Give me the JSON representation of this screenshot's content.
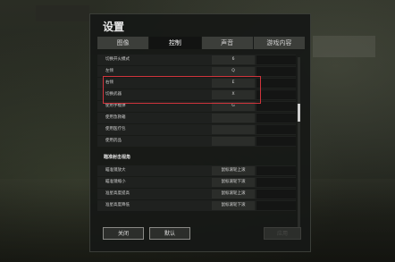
{
  "window": {
    "title": "设置"
  },
  "tabs": [
    {
      "label": "图像",
      "active": false
    },
    {
      "label": "控制",
      "active": true
    },
    {
      "label": "声音",
      "active": false
    },
    {
      "label": "游戏内容",
      "active": false
    }
  ],
  "rows": [
    {
      "label": "切换开火模式",
      "value": "6"
    },
    {
      "label": "左倾",
      "value": "Q",
      "highlighted": true
    },
    {
      "label": "右倾",
      "value": "E",
      "highlighted": true
    },
    {
      "label": "切换武器",
      "value": "X"
    },
    {
      "label": "使用手榴弹",
      "value": "G"
    },
    {
      "label": "使用急救箱",
      "value": ""
    },
    {
      "label": "使用医疗包",
      "value": ""
    },
    {
      "label": "使用药品",
      "value": ""
    }
  ],
  "section_header": "瞄准射击视角",
  "scope_rows": [
    {
      "label": "瞄准镜放大",
      "value": "鼠标滚轮上滚"
    },
    {
      "label": "瞄准镜缩小",
      "value": "鼠标滚轮下滚"
    },
    {
      "label": "准星高度提高",
      "value": "鼠标滚轮上滚"
    },
    {
      "label": "准星高度降低",
      "value": "鼠标滚轮下滚"
    }
  ],
  "footer": {
    "close_label": "关闭",
    "default_label": "默认",
    "apply_label": "应用"
  },
  "colors": {
    "highlight_border": "#d0343c",
    "active_tab": "#121312",
    "tab_bg": "#3c3e3a"
  }
}
